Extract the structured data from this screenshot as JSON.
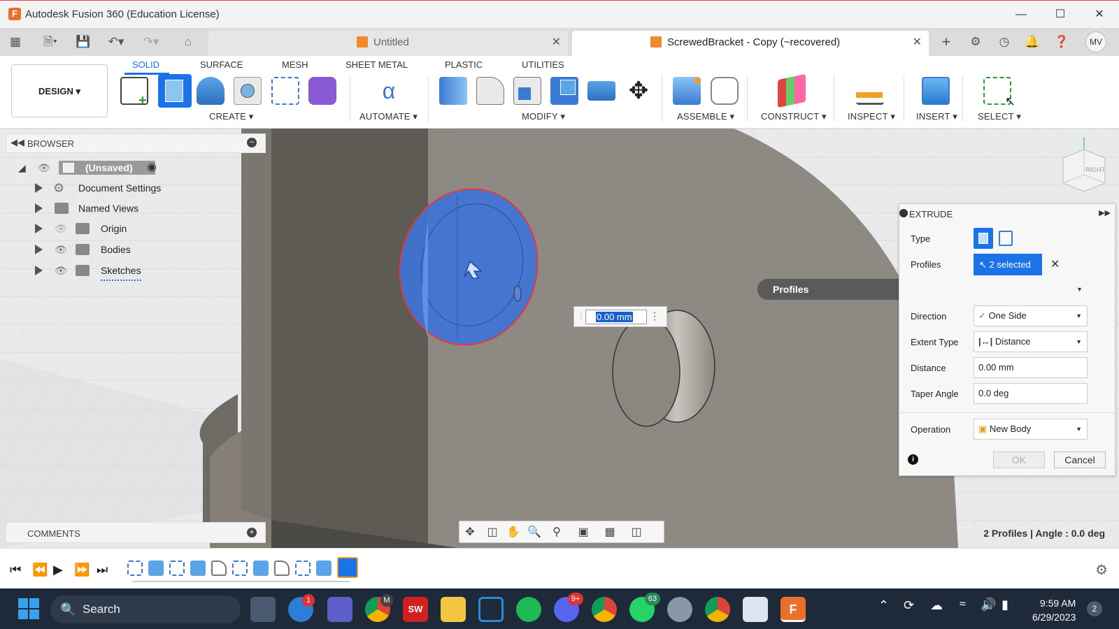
{
  "window": {
    "title": "Autodesk Fusion 360 (Education License)",
    "minimize_icon": "minimize-icon",
    "maximize_icon": "maximize-icon",
    "close_icon": "close-icon"
  },
  "doc_tabs": [
    {
      "label": "Untitled",
      "active": false
    },
    {
      "label": "ScrewedBracket - Copy (~recovered)",
      "active": true
    }
  ],
  "account_initials": "MV",
  "ribbon": {
    "workspace": "DESIGN",
    "tabs": [
      "SOLID",
      "SURFACE",
      "MESH",
      "SHEET METAL",
      "PLASTIC",
      "UTILITIES"
    ],
    "active_tab": "SOLID",
    "groups": [
      "CREATE",
      "AUTOMATE",
      "MODIFY",
      "ASSEMBLE",
      "CONSTRUCT",
      "INSPECT",
      "INSERT",
      "SELECT"
    ]
  },
  "browser": {
    "title": "BROWSER",
    "root": "(Unsaved)",
    "items": [
      "Document Settings",
      "Named Views",
      "Origin",
      "Bodies",
      "Sketches"
    ]
  },
  "comments": {
    "title": "COMMENTS"
  },
  "viewcube": {
    "face": "RIGHT"
  },
  "tooltip": "Profiles",
  "dimension_input": "0.00 mm",
  "extrude": {
    "title": "EXTRUDE",
    "type_label": "Type",
    "profiles_label": "Profiles",
    "profiles_value": "2 selected",
    "direction_label": "Direction",
    "direction_value": "One Side",
    "extent_label": "Extent Type",
    "extent_value": "Distance",
    "distance_label": "Distance",
    "distance_value": "0.00 mm",
    "taper_label": "Taper Angle",
    "taper_value": "0.0 deg",
    "operation_label": "Operation",
    "operation_value": "New Body",
    "ok": "OK",
    "cancel": "Cancel"
  },
  "status_text": "2 Profiles | Angle : 0.0 deg",
  "taskbar": {
    "search": "Search",
    "time": "9:59 AM",
    "date": "6/29/2023",
    "notification_count": "2",
    "badges": {
      "onedrive": "1",
      "discord": "9+",
      "whatsapp": "63",
      "chrome_profile": "M"
    }
  },
  "colors": {
    "accent": "#1a73e8",
    "profile_selection": "#3f74d6",
    "model_face": "#8b8780",
    "title_bar": "#f3f3f3",
    "taskbar": "#1e2a3a"
  }
}
